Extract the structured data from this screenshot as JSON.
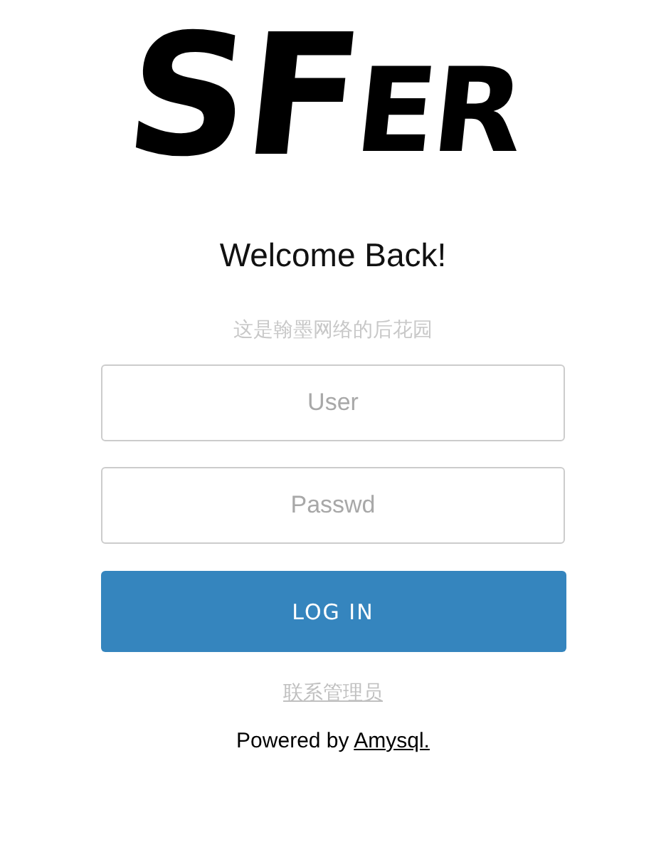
{
  "logo": [
    "SF",
    "ER"
  ],
  "heading": "Welcome Back!",
  "subtitle": "这是翰墨网络的后花园",
  "fields": [
    {
      "placeholder": "User"
    },
    {
      "placeholder": "Passwd"
    }
  ],
  "login_button": "LOG IN",
  "admin_link": "联系管理员",
  "footer": {
    "prefix": "Powered by ",
    "link": "Amysql."
  }
}
